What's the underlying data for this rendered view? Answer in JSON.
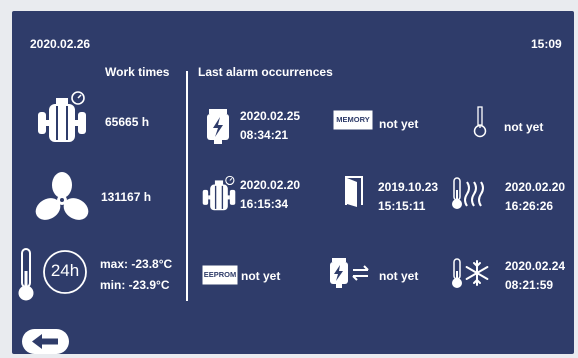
{
  "header": {
    "date": "2020.02.26",
    "time": "15:09"
  },
  "work": {
    "title": "Work times",
    "compressor_hours": "65665 h",
    "fan_hours": "131167 h",
    "clock_badge": "24h",
    "temp_max": "max: -23.8°C",
    "temp_min": "min: -23.9°C"
  },
  "alarms": {
    "title": "Last alarm occurrences",
    "power_failure": {
      "date": "2020.02.25",
      "time": "08:34:21"
    },
    "memory": {
      "label": "MEMORY",
      "value": "not yet"
    },
    "sensor": {
      "value": "not yet"
    },
    "compressor": {
      "date": "2020.02.20",
      "time": "16:15:34"
    },
    "door": {
      "date": "2019.10.23",
      "time": "15:15:11"
    },
    "high_temp": {
      "date": "2020.02.20",
      "time": "16:26:26"
    },
    "eeprom": {
      "label": "EEPROM",
      "value": "not yet"
    },
    "communication": {
      "value": "not yet"
    },
    "low_temp": {
      "date": "2020.02.24",
      "time": "08:21:59"
    }
  },
  "colors": {
    "panel": "#2f3c6a",
    "foreground": "#ffffff",
    "frame": "#e9ebef"
  },
  "icons": {
    "compressor": "compressor-icon",
    "fan": "fan-icon",
    "thermometer": "thermometer-icon",
    "clock24": "clock-24h-icon",
    "power": "power-failure-icon",
    "memory": "memory-chip-icon",
    "sensor": "sensor-icon",
    "door": "door-icon",
    "heat": "high-temperature-icon",
    "eeprom": "eeprom-chip-icon",
    "comm": "communication-icon",
    "snow": "low-temperature-icon",
    "back": "back-arrow-icon"
  }
}
